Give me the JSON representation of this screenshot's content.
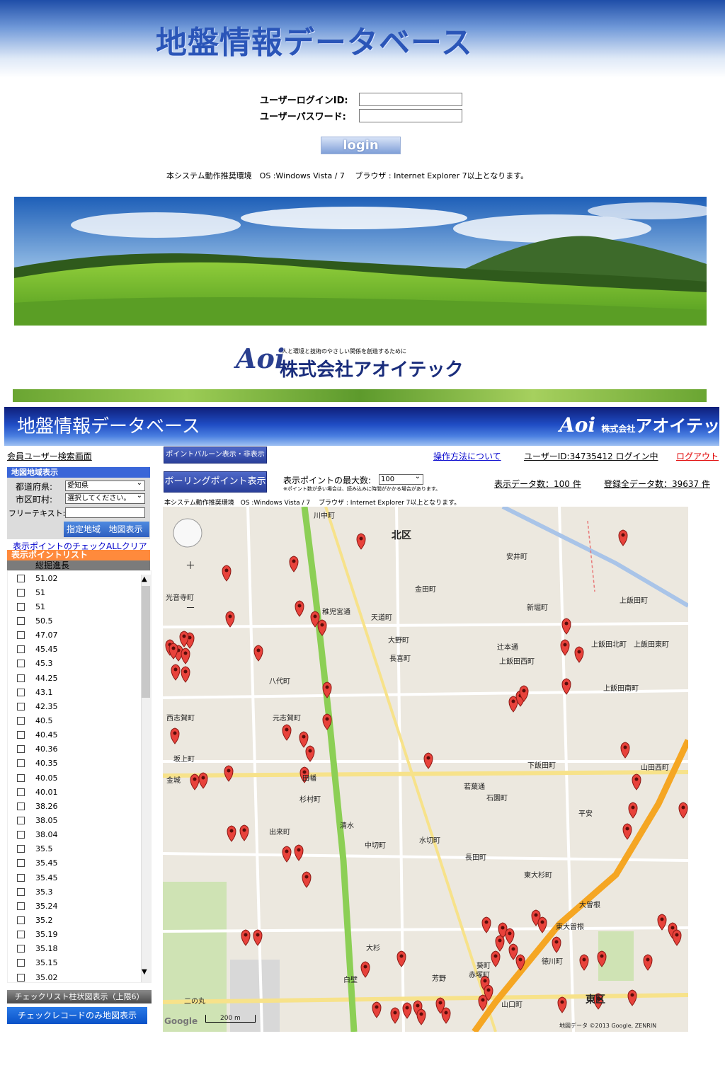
{
  "top": {
    "title": "地盤情報データベース",
    "login": {
      "id_label": "ユーザーログインID:",
      "pw_label": "ユーザーパスワード:",
      "button": "login"
    },
    "env_note": "本システム動作推奨環境　OS :Windows Vista / 7　 ブラウザ : Internet Explorer 7以上となります。",
    "company": {
      "mark": "Aoi",
      "tagline": "人と環境と技術のやさしい関係を創造するために",
      "name": "株式会社アオイテック"
    }
  },
  "app": {
    "title": "地盤情報データベース",
    "logo_mark": "Aoi",
    "logo_small": "株式会社",
    "logo_name": "アオイテック",
    "member_title": "会員ユーザー検索画面",
    "balloon_button": "ポイントバルーン表示・非表示",
    "howto_link": "操作方法について",
    "user_id": "ユーザーID:34735412  ログイン中",
    "logout": "ログアウト",
    "boring_button": "ボーリングポイント表示",
    "max_points_label": "表示ポイントの最大数:",
    "max_points_value": "100",
    "max_points_note": "※ポイント数が多い場合は、読み込みに時間がかかる場合があります。",
    "display_count": "表示データ数：100 件",
    "total_count": "登録全データ数：39637 件",
    "env_note": "本システム動作推奨環境　OS :Windows Vista / 7　 ブラウザ : Internet Explorer 7以上となります。",
    "region": {
      "header": "地図地域表示",
      "pref_label": "都道府県:",
      "pref_value": "愛知県",
      "city_label": "市区町村:",
      "city_value": "選択してください。",
      "free_label": "フリーテキスト:",
      "btn_region": "指定地域",
      "btn_map": "地図表示"
    },
    "clear_all": "表示ポイントのチェックALLクリア",
    "point_list_header": "表示ポイントリスト",
    "column_header": "総掘進長",
    "points": [
      "51.02",
      "51",
      "51",
      "50.5",
      "47.07",
      "45.45",
      "45.3",
      "44.25",
      "43.1",
      "42.35",
      "40.5",
      "40.45",
      "40.36",
      "40.35",
      "40.05",
      "40.01",
      "38.26",
      "38.05",
      "38.04",
      "35.5",
      "35.45",
      "35.45",
      "35.3",
      "35.24",
      "35.2",
      "35.19",
      "35.18",
      "35.15",
      "35.02"
    ],
    "btn_check_list": "チェックリスト柱状図表示（上限6）",
    "btn_check_map": "チェックレコードのみ地図表示"
  },
  "map": {
    "labels": [
      {
        "t": "北区"
      },
      {
        "t": "東区"
      },
      {
        "t": "八代町"
      },
      {
        "t": "元志賀町"
      },
      {
        "t": "安井町"
      },
      {
        "t": "上飯田町"
      },
      {
        "t": "大曽根"
      },
      {
        "t": "徳川町"
      },
      {
        "t": "山口町"
      },
      {
        "t": "葵町"
      },
      {
        "t": "清水"
      },
      {
        "t": "杉村町"
      },
      {
        "t": "大杉"
      },
      {
        "t": "白壁"
      },
      {
        "t": "芳野"
      },
      {
        "t": "赤塚町"
      },
      {
        "t": "東大曽根"
      },
      {
        "t": "平安"
      },
      {
        "t": "石園町"
      },
      {
        "t": "水切町"
      },
      {
        "t": "中切町"
      },
      {
        "t": "長田町"
      },
      {
        "t": "天道町"
      },
      {
        "t": "大野町"
      },
      {
        "t": "長喜町"
      },
      {
        "t": "田幡"
      },
      {
        "t": "金城"
      },
      {
        "t": "東大杉町"
      },
      {
        "t": "出来町"
      },
      {
        "t": "二の丸"
      },
      {
        "t": "坂上町"
      },
      {
        "t": "西志賀町"
      },
      {
        "t": "下飯田町"
      },
      {
        "t": "上飯田西町"
      },
      {
        "t": "上飯田北町"
      },
      {
        "t": "上飯田東町"
      },
      {
        "t": "新堀町"
      },
      {
        "t": "辻本通"
      },
      {
        "t": "川中町"
      },
      {
        "t": "金田町"
      },
      {
        "t": "光音寺町"
      },
      {
        "t": "稚児宮通"
      },
      {
        "t": "若葉通"
      },
      {
        "t": "上飯田南町"
      },
      {
        "t": "山田西町"
      }
    ],
    "scale": "200 m",
    "copyright": "地図データ ©2013 Google, ZENRIN"
  }
}
